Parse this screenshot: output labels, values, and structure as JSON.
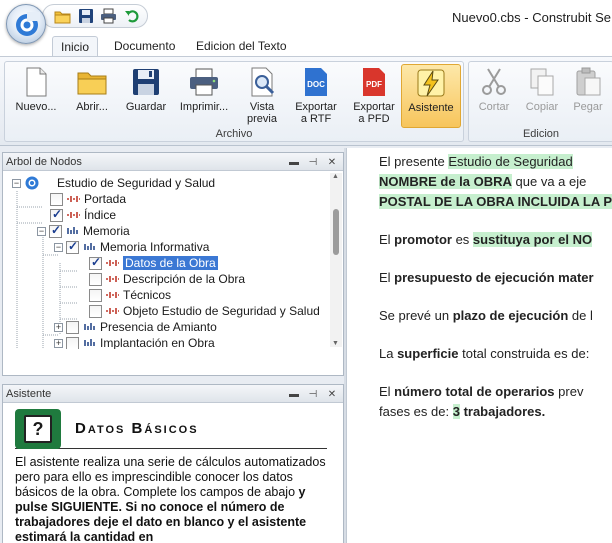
{
  "window": {
    "title": "Nuevo0.cbs - Construbit Se"
  },
  "quick_access": [
    "open-folder-icon",
    "save-disk-icon",
    "print-icon",
    "undo-icon"
  ],
  "ribbon": {
    "tabs": [
      {
        "label": "Inicio",
        "active": true
      },
      {
        "label": "Documento",
        "active": false
      },
      {
        "label": "Edicion del Texto",
        "active": false
      }
    ],
    "archivo": {
      "label": "Archivo",
      "buttons": {
        "nuevo": "Nuevo...",
        "abrir": "Abrir...",
        "guardar": "Guardar",
        "imprimir": "Imprimir...",
        "vista_1": "Vista",
        "vista_2": "previa",
        "rtf_1": "Exportar",
        "rtf_2": "a RTF",
        "rtf_badge": "DOC",
        "pfd_1": "Exportar",
        "pfd_2": "a PFD",
        "pfd_badge": "PDF",
        "asistente": "Asistente"
      }
    },
    "edicion": {
      "label": "Edicion",
      "buttons": {
        "cortar": "Cortar",
        "copiar": "Copiar",
        "pegar": "Pegar"
      }
    }
  },
  "tree_pane": {
    "title": "Arbol de Nodos",
    "nodes": {
      "root": "Estudio de Seguridad y Salud",
      "portada": "Portada",
      "indice": "Índice",
      "memoria": "Memoria",
      "memoria_informativa": "Memoria Informativa",
      "datos_obra": "Datos de la Obra",
      "descripcion_obra": "Descripción de la Obra",
      "tecnicos": "Técnicos",
      "objeto_estudio": "Objeto Estudio de Seguridad y Salud",
      "amianto": "Presencia de Amianto",
      "implantacion": "Implantación en Obra"
    }
  },
  "wizard_pane": {
    "title": "Asistente",
    "heading": "Datos Básicos",
    "icon_glyph": "?",
    "text_1": "El asistente realiza una serie de cálculos automatizados pero para ello es imprescindible conocer los datos básicos de la obra. Complete los campos de abajo ",
    "text_bold": "y pulse SIGUIENTE. Si no conoce el número de trabajadores deje el dato en blanco y el asistente estimará la cantidad en"
  },
  "document": {
    "p1_a": "El presente ",
    "p1_hl": "Estudio de Seguridad",
    "p1_line2_a": "NOMBRE de la OBRA",
    "p1_line2_b": " que va a eje",
    "p1_line3": "POSTAL DE LA OBRA INCLUIDA LA P",
    "p2_a": "El ",
    "p2_b": "promotor",
    "p2_c": " es ",
    "p2_d": "sustituya por el NO",
    "p3_a": "El ",
    "p3_b": "presupuesto de ejecución mater",
    "p4_a": "Se prevé un ",
    "p4_b": "plazo de ejecución",
    "p4_c": " de l",
    "p5_a": "La ",
    "p5_b": "superficie",
    "p5_c": " total construida es de:",
    "p6_a": "El ",
    "p6_b": "número total de operarios",
    "p6_c": " prev",
    "p6_line2_a": "fases es de: ",
    "p6_line2_num": "3",
    "p6_line2_b": " trabajadores."
  }
}
